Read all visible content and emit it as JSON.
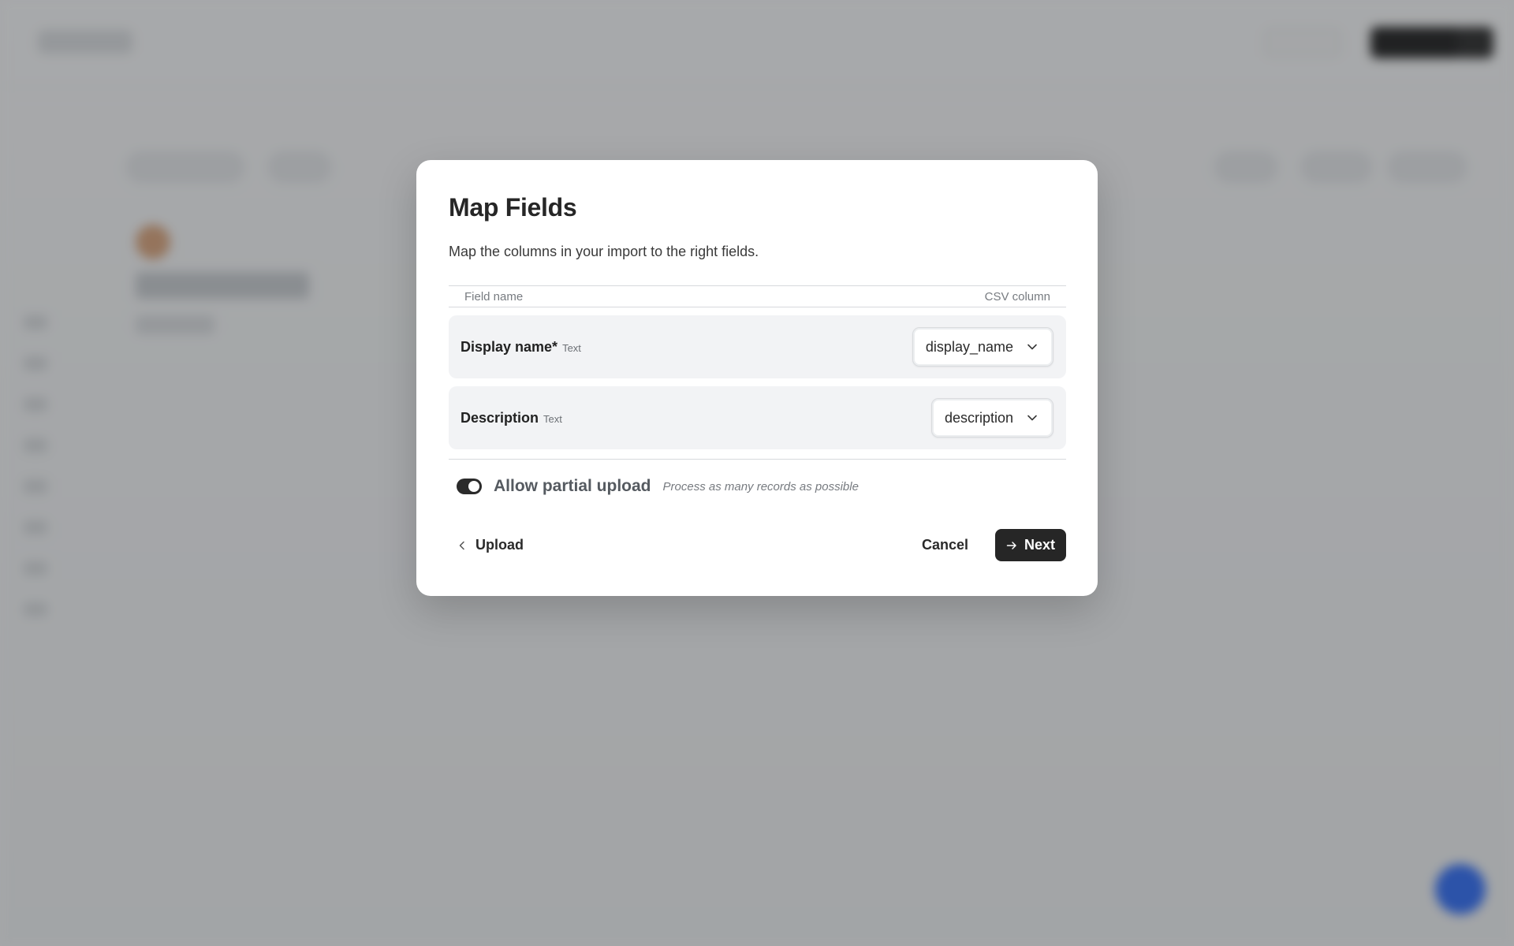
{
  "modal": {
    "title": "Map Fields",
    "subtitle": "Map the columns in your import to the right fields.",
    "table_header": {
      "field_name": "Field name",
      "csv_column": "CSV column"
    },
    "rows": [
      {
        "field": "Display name*",
        "type": "Text",
        "selected_column": "display_name"
      },
      {
        "field": "Description",
        "type": "Text",
        "selected_column": "description"
      }
    ],
    "partial_upload": {
      "label": "Allow partial upload",
      "hint": "Process as many records as possible",
      "enabled": true
    },
    "footer": {
      "back_label": "Upload",
      "cancel_label": "Cancel",
      "next_label": "Next"
    }
  },
  "colors": {
    "primary_button": "#262626",
    "overlay": "rgba(40,42,46,0.38)",
    "fab": "#2f6cf6"
  }
}
